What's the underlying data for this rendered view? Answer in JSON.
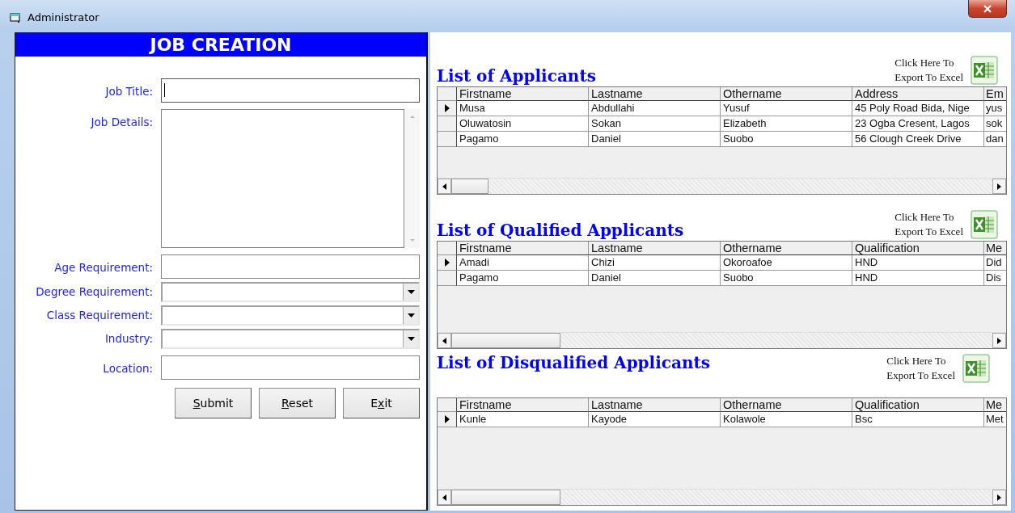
{
  "window": {
    "title": "Administrator"
  },
  "job_creation": {
    "title": "JOB CREATION",
    "fields": [
      {
        "label": "Job Title:",
        "kind": "text",
        "focused": true
      },
      {
        "label": "Job Details:",
        "kind": "textarea",
        "focused": false
      },
      {
        "label": "Age Requirement:",
        "kind": "text",
        "focused": false
      },
      {
        "label": "Degree Requirement:",
        "kind": "dropdown",
        "focused": false
      },
      {
        "label": "Class Requirement:",
        "kind": "dropdown",
        "focused": false
      },
      {
        "label": "Industry:",
        "kind": "dropdown",
        "focused": false
      },
      {
        "label": "Location:",
        "kind": "text",
        "focused": false
      }
    ],
    "buttons": [
      {
        "key": "S",
        "after": "ubmit"
      },
      {
        "key": "R",
        "after": "eset"
      },
      {
        "before": "E",
        "key": "x",
        "after": "it"
      }
    ]
  },
  "lists": [
    {
      "title": "List of Applicants",
      "export_link": [
        "Click Here To",
        "Export To Excel"
      ],
      "columns": [
        "Firstname",
        "Lastname",
        "Othername",
        "Address",
        "Em"
      ],
      "rows": [
        {
          "current": true,
          "cells": [
            "Musa",
            "Abdullahi",
            "Yusuf",
            "45 Poly Road Bida, Nige",
            "yus"
          ]
        },
        {
          "current": false,
          "cells": [
            "Oluwatosin",
            "Sokan",
            "Elizabeth",
            "23 Ogba Cresent, Lagos",
            "sok"
          ]
        },
        {
          "current": false,
          "cells": [
            "Pagamo",
            "Daniel",
            "Suobo",
            "56 Clough Creek Drive",
            "dan"
          ]
        }
      ]
    },
    {
      "title": "List of Qualified Applicants",
      "export_link": [
        "Click Here To",
        "Export To Excel"
      ],
      "columns": [
        "Firstname",
        "Lastname",
        "Othername",
        "Qualification",
        "Me"
      ],
      "rows": [
        {
          "current": true,
          "cells": [
            "Amadi",
            "Chizi",
            "Okoroafoe",
            "HND",
            "Did"
          ]
        },
        {
          "current": false,
          "cells": [
            "Pagamo",
            "Daniel",
            "Suobo",
            "HND",
            "Dis"
          ]
        }
      ]
    },
    {
      "title": "List of Disqualified Applicants",
      "export_link": [
        "Click Here To",
        "Export To Excel"
      ],
      "columns": [
        "Firstname",
        "Lastname",
        "Othername",
        "Qualification",
        "Me"
      ],
      "rows": [
        {
          "current": true,
          "cells": [
            "Kunle",
            "Kayode",
            "Kolawole",
            "Bsc",
            "Met"
          ]
        }
      ]
    }
  ]
}
